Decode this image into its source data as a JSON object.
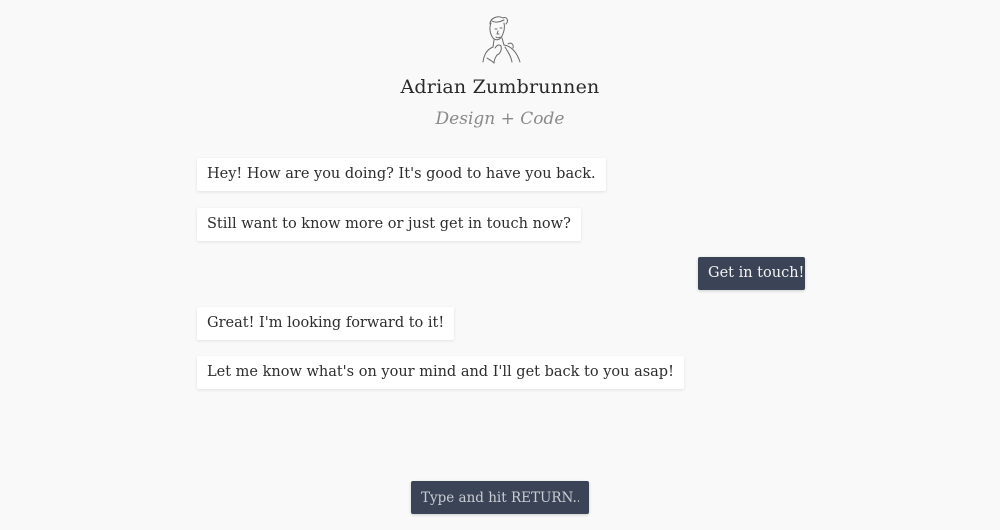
{
  "profile": {
    "avatar_icon": "sketch-portrait-icon",
    "name": "Adrian Zumbrunnen",
    "tagline": "Design + Code"
  },
  "messages": [
    {
      "from": "bot",
      "text": "Hey! How are you doing? It's good to have you back."
    },
    {
      "from": "bot",
      "text": "Still want to know more or just get in touch now?"
    },
    {
      "from": "user",
      "text": "Get in touch!"
    },
    {
      "from": "bot",
      "text": "Great! I'm looking forward to it!"
    },
    {
      "from": "bot",
      "text": "Let me know what's on your mind and I'll get back to you asap!"
    }
  ],
  "composer": {
    "placeholder": "Type and hit RETURN...",
    "value": ""
  },
  "colors": {
    "background": "#f9f9f9",
    "bot_bubble": "#ffffff",
    "user_bubble": "#3b4456",
    "tagline": "#8a8a8a"
  }
}
